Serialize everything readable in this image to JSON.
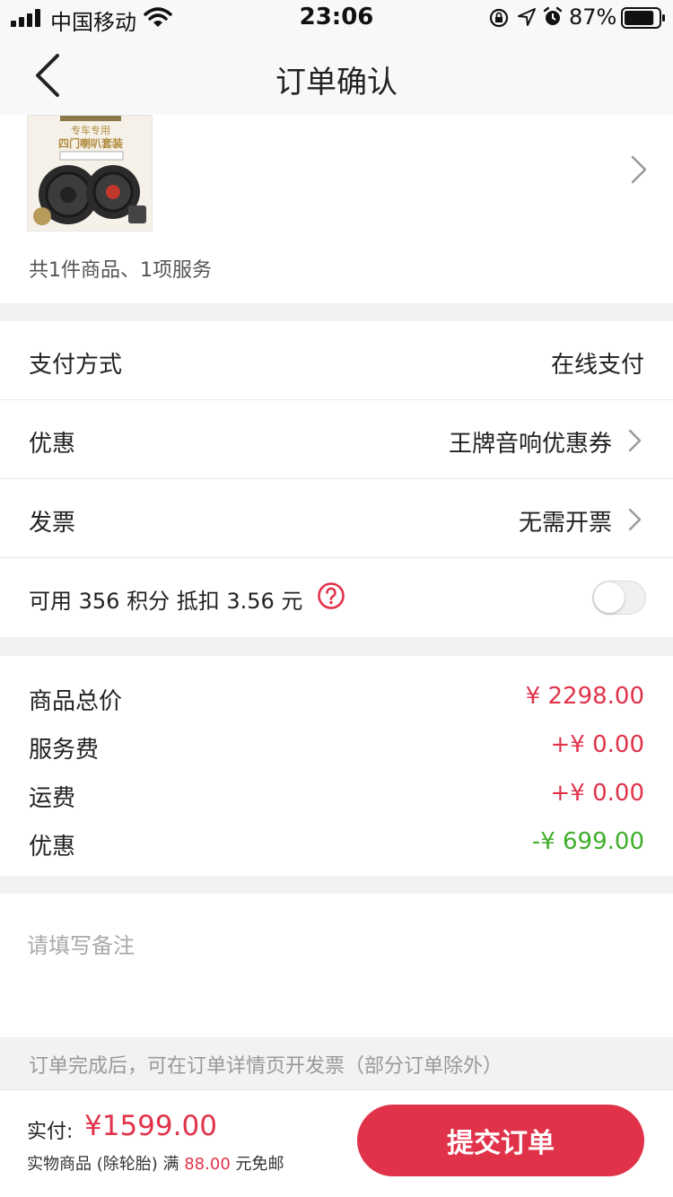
{
  "status_bar": {
    "carrier": "中国移动",
    "time": "23:06",
    "battery_percent": "87%",
    "battery_level": 0.87
  },
  "nav": {
    "title": "订单确认",
    "back_icon": "chevron-left-icon"
  },
  "product": {
    "image_caption_line1": "专车专用",
    "image_caption_line2": "四门喇叭套装",
    "summary": "共1件商品、1项服务"
  },
  "options": {
    "payment": {
      "label": "支付方式",
      "value": "在线支付"
    },
    "discount": {
      "label": "优惠",
      "value": "王牌音响优惠券"
    },
    "invoice": {
      "label": "发票",
      "value": "无需开票"
    },
    "points": {
      "label": "可用 356 积分 抵扣 3.56 元",
      "toggle_on": false
    }
  },
  "prices": [
    {
      "label": "商品总价",
      "value": "¥ 2298.00",
      "color": "#e0334a"
    },
    {
      "label": "服务费",
      "value": "+¥ 0.00",
      "color": "#e0334a"
    },
    {
      "label": "运费",
      "value": "+¥ 0.00",
      "color": "#e0334a"
    },
    {
      "label": "优惠",
      "value": "-¥ 699.00",
      "color": "#3fae2a"
    }
  ],
  "remark": {
    "placeholder": "请填写备注",
    "value": ""
  },
  "notice": "订单完成后，可在订单详情页开发票（部分订单除外）",
  "footer": {
    "pay_label": "实付:",
    "pay_amount": "¥1599.00",
    "shipping_prefix": "实物商品 (除轮胎) 满",
    "shipping_amount": "88.00",
    "shipping_suffix": "元免邮",
    "submit_label": "提交订单"
  },
  "colors": {
    "accent": "#e0334a",
    "discount": "#3fae2a"
  }
}
